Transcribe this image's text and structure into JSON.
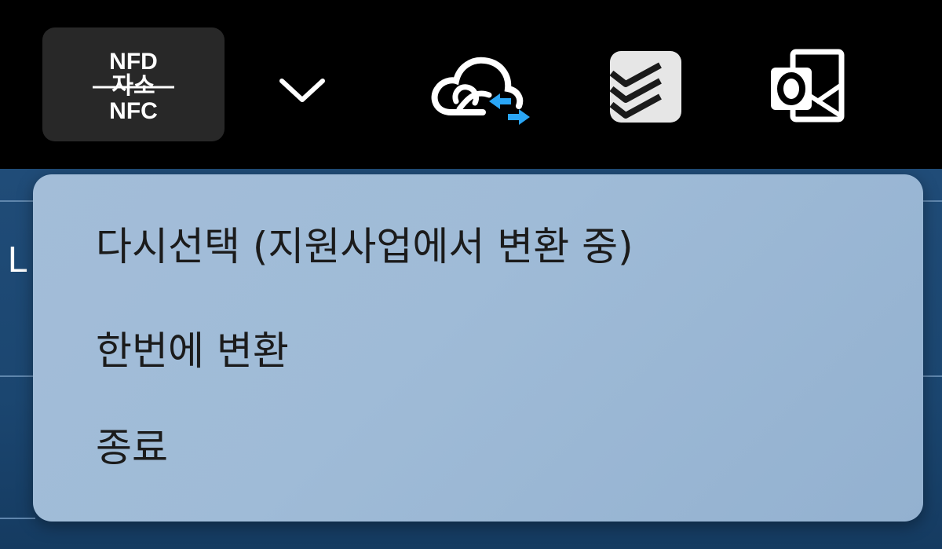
{
  "tray": {
    "items": [
      {
        "name": "nfd-nfc-converter",
        "icon": "nfd-nfc-icon",
        "lines": [
          "NFD",
          "자소",
          "NFC"
        ]
      },
      {
        "name": "show-hidden-icons",
        "icon": "chevron-down-icon"
      },
      {
        "name": "creative-cloud",
        "icon": "creative-cloud-sync-icon"
      },
      {
        "name": "todoist",
        "icon": "todoist-icon"
      },
      {
        "name": "outlook",
        "icon": "outlook-icon"
      }
    ]
  },
  "desktop": {
    "partial_letter": "L"
  },
  "context_menu": {
    "items": [
      {
        "label": "다시선택 (지원사업에서 변환 중)"
      },
      {
        "label": "한번에 변환"
      },
      {
        "label": "종료"
      }
    ]
  },
  "colors": {
    "taskbar_bg": "#000000",
    "tray_selected_bg": "#282828",
    "menu_bg": "#a3bdd8",
    "menu_text": "#1b1b1b",
    "desktop_bg": "#1d4873",
    "cc_arrow_accent": "#2aa5f5"
  }
}
